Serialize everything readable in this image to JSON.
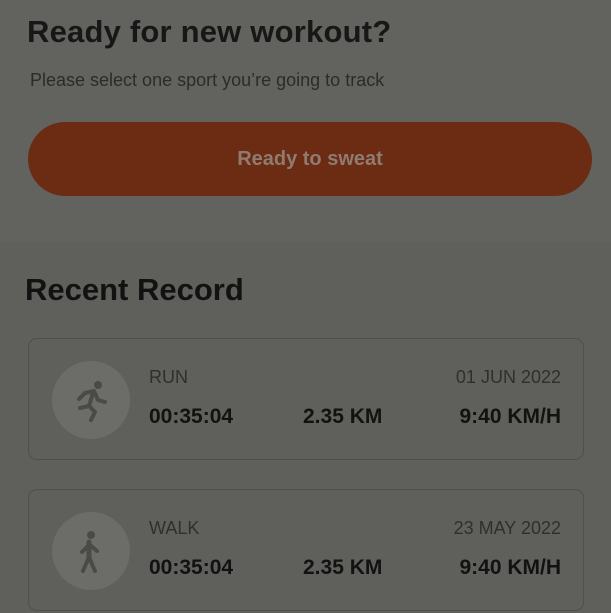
{
  "header": {
    "title": "Ready for new workout?",
    "subtitle": "Please select one sport you’re going to track",
    "cta_label": "Ready to sweat"
  },
  "recent": {
    "title": "Recent Record",
    "records": [
      {
        "sport": "RUN",
        "date": "01 JUN 2022",
        "duration": "00:35:04",
        "distance": "2.35 KM",
        "speed": "9:40 KM/H",
        "icon": "running-person-icon"
      },
      {
        "sport": "WALK",
        "date": "23 MAY 2022",
        "duration": "00:35:04",
        "distance": "2.35 KM",
        "speed": "9:40 KM/H",
        "icon": "walking-person-icon"
      }
    ]
  },
  "colors": {
    "overlay_background": "#5f5f5b",
    "accent_button": "#6c2c13"
  }
}
